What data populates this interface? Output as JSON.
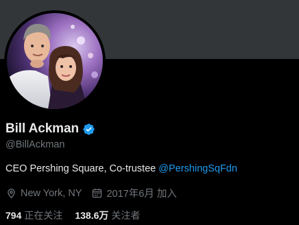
{
  "profile": {
    "display_name": "Bill Ackman",
    "verified": true,
    "handle": "@BillAckman",
    "bio_text": "CEO Pershing Square, Co-trustee ",
    "bio_mention": "@PershingSqFdn",
    "location": "New York, NY",
    "joined": "2017年6月 加入",
    "following_count": "794",
    "following_label": "正在关注",
    "followers_count": "138.6万",
    "followers_label": "关注者"
  },
  "icons": {
    "location": "location-pin-icon",
    "joined": "calendar-icon",
    "verified": "verified-badge-icon"
  },
  "colors": {
    "background": "#000000",
    "banner": "#333639",
    "primary_text": "#e7e9ea",
    "secondary_text": "#71767b",
    "accent": "#1d9bf0"
  }
}
